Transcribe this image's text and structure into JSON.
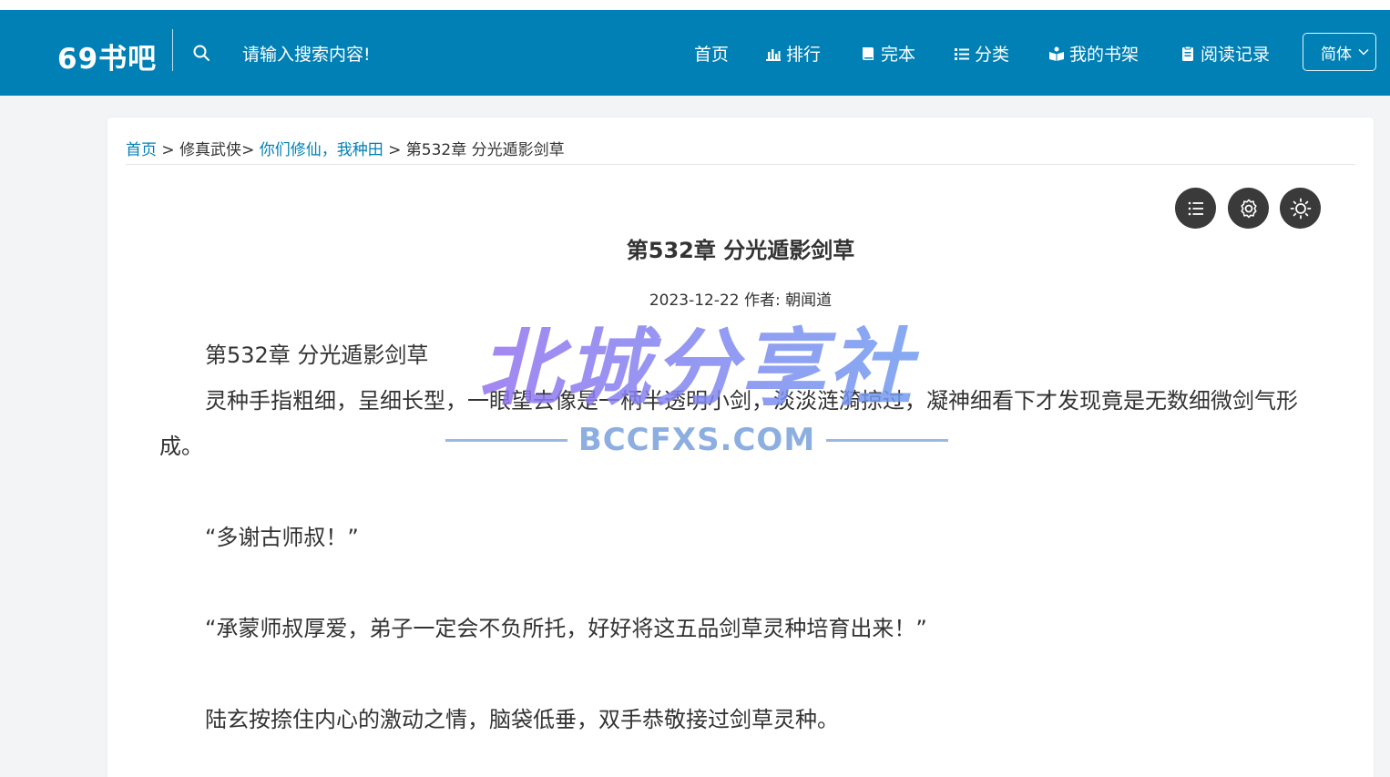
{
  "header": {
    "logo": "69书吧",
    "search_placeholder": "请输入搜索内容!",
    "nav": [
      {
        "label": "首页",
        "icon": "none"
      },
      {
        "label": "排行",
        "icon": "bar-chart-icon"
      },
      {
        "label": "完本",
        "icon": "book-icon"
      },
      {
        "label": "分类",
        "icon": "list-icon"
      },
      {
        "label": "我的书架",
        "icon": "bookshelf-icon"
      },
      {
        "label": "阅读记录",
        "icon": "history-icon"
      }
    ],
    "language": "简体"
  },
  "breadcrumb": {
    "home": "首页",
    "sep1": " > ",
    "category": "修真武侠",
    "sep2": "> ",
    "book": "你们修仙，我种田",
    "sep3": " > ",
    "chapter": "第532章 分光遁影剑草"
  },
  "tools": [
    "list-icon",
    "settings-icon",
    "brightness-icon"
  ],
  "chapter": {
    "title": "第532章 分光遁影剑草",
    "meta": "2023-12-22 作者:  朝闻道",
    "paragraphs": [
      "第532章 分光遁影剑草",
      "灵种手指粗细，呈细长型，一眼望去像是一柄半透明小剑，淡淡涟漪掠过，凝神细看下才发现竟是无数细微剑气形成。",
      "",
      "“多谢古师叔！”",
      "",
      "“承蒙师叔厚爱，弟子一定会不负所托，好好将这五品剑草灵种培育出来！”",
      "",
      "陆玄按捺住内心的激动之情，脑袋低垂，双手恭敬接过剑草灵种。"
    ]
  },
  "watermark": {
    "title": "北城分享社",
    "subtitle": "BCCFXS.COM"
  },
  "colors": {
    "brand": "#0180b5",
    "background": "#f3f4f6",
    "tool_button": "#3a3a3a"
  }
}
